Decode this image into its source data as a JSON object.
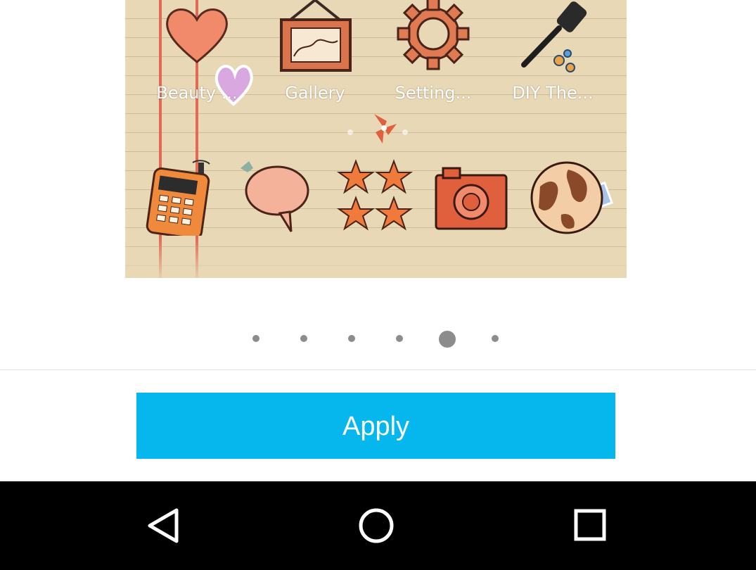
{
  "preview": {
    "top_apps": [
      {
        "label": "Beauty ...",
        "icon": "heart-icon"
      },
      {
        "label": "Gallery",
        "icon": "picture-frame-icon"
      },
      {
        "label": "Setting...",
        "icon": "gear-icon"
      },
      {
        "label": "DIY The...",
        "icon": "paintbrush-icon"
      }
    ],
    "dock": [
      {
        "icon": "phone-icon"
      },
      {
        "icon": "speech-bubble-icon"
      },
      {
        "icon": "stars-icon"
      },
      {
        "icon": "camera-icon"
      },
      {
        "icon": "globe-icon"
      }
    ]
  },
  "pager": {
    "count": 6,
    "active_index": 4
  },
  "apply_button": {
    "label": "Apply",
    "color": "#06b7ee"
  },
  "navbar": {
    "back": "back-icon",
    "home": "home-icon",
    "recents": "recents-icon"
  }
}
